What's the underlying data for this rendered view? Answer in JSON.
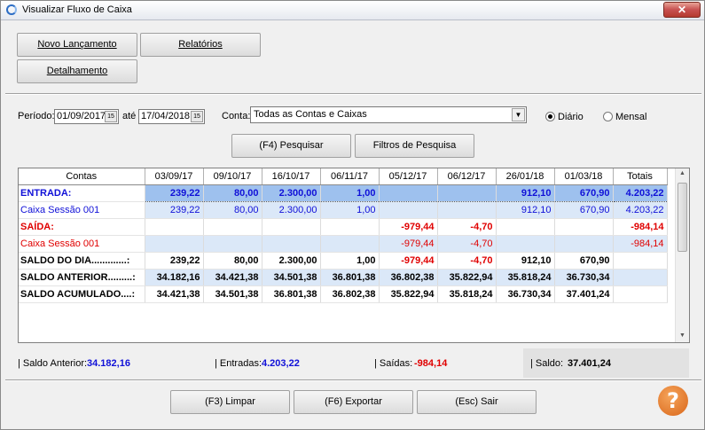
{
  "window": {
    "title": "Visualizar Fluxo de Caixa",
    "close_label": "✕"
  },
  "toolbar": {
    "novo_lancamento": "Novo Lançamento",
    "relatorios": "Relatórios",
    "detalhamento": "Detalhamento"
  },
  "filters": {
    "periodo_label": "Período:",
    "date_from": "01/09/2017",
    "ate_label": "até",
    "date_to": "17/04/2018",
    "conta_label": "Conta:",
    "conta_value": "Todas as Contas e Caixas",
    "diario_label": "Diário",
    "mensal_label": "Mensal",
    "selected_mode": "Diário",
    "pesquisar": "(F4) Pesquisar",
    "filtros": "Filtros de Pesquisa",
    "date_spin_label": "15"
  },
  "grid": {
    "headers": [
      "Contas",
      "03/09/17",
      "09/10/17",
      "16/10/17",
      "06/11/17",
      "05/12/17",
      "06/12/17",
      "26/01/18",
      "01/03/18",
      "Totais"
    ],
    "rows": [
      {
        "name": "ENTRADA:",
        "values": [
          "239,22",
          "80,00",
          "2.300,00",
          "1,00",
          "",
          "",
          "912,10",
          "670,90",
          "4.203,22"
        ]
      },
      {
        "name": "Caixa Sessão 001",
        "values": [
          "239,22",
          "80,00",
          "2.300,00",
          "1,00",
          "",
          "",
          "912,10",
          "670,90",
          "4.203,22"
        ]
      },
      {
        "name": "SAÍDA:",
        "values": [
          "",
          "",
          "",
          "",
          "-979,44",
          "-4,70",
          "",
          "",
          "-984,14"
        ]
      },
      {
        "name": "Caixa Sessão 001",
        "values": [
          "",
          "",
          "",
          "",
          "-979,44",
          "-4,70",
          "",
          "",
          "-984,14"
        ]
      },
      {
        "name": "SALDO DO DIA.............:",
        "values": [
          "239,22",
          "80,00",
          "2.300,00",
          "1,00",
          "-979,44",
          "-4,70",
          "912,10",
          "670,90",
          ""
        ]
      },
      {
        "name": "SALDO ANTERIOR.........:",
        "values": [
          "34.182,16",
          "34.421,38",
          "34.501,38",
          "36.801,38",
          "36.802,38",
          "35.822,94",
          "35.818,24",
          "36.730,34",
          ""
        ]
      },
      {
        "name": "SALDO ACUMULADO....:",
        "values": [
          "34.421,38",
          "34.501,38",
          "36.801,38",
          "36.802,38",
          "35.822,94",
          "35.818,24",
          "36.730,34",
          "37.401,24",
          ""
        ]
      }
    ]
  },
  "summary": {
    "saldo_anterior_label": "| Saldo Anterior:",
    "saldo_anterior_value": "34.182,16",
    "entradas_label": "| Entradas:",
    "entradas_value": "4.203,22",
    "saidas_label": "| Saídas:",
    "saidas_value": "-984,14",
    "saldo_label": "| Saldo:",
    "saldo_value": "37.401,24"
  },
  "footer": {
    "limpar": "(F3) Limpar",
    "exportar": "(F6) Exportar",
    "sair": "(Esc) Sair",
    "help_glyph": "?"
  },
  "colors": {
    "positive": "#1010d8",
    "negative": "#e00000",
    "selected_row": "#9ec1ee",
    "light_row": "#dbe8f8",
    "help": "#e07a2a"
  }
}
